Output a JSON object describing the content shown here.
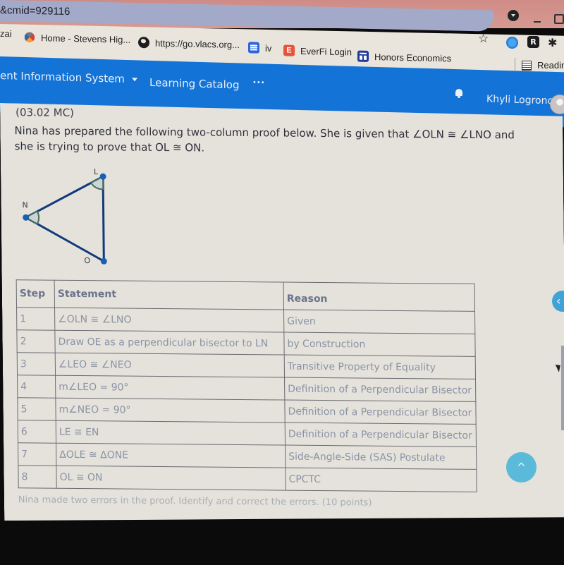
{
  "browser": {
    "url_fragment": "&cmid=929116",
    "bookmarks": [
      {
        "label": "zai"
      },
      {
        "label": "Home - Stevens Hig...",
        "icon": "stevens-logo-icon"
      },
      {
        "label": "https://go.vlacs.org...",
        "icon": "globe-icon"
      },
      {
        "label": "iv",
        "icon": "document-icon"
      },
      {
        "label": "EverFi Login",
        "icon": "everfi-icon",
        "icon_letter": "E"
      },
      {
        "label": "Honors Economics",
        "icon": "classroom-icon"
      }
    ],
    "extension_r_label": "R",
    "reading_list_label": "Reading",
    "star_glyph": "☆",
    "puzzle_glyph": "✱"
  },
  "navbar": {
    "items": [
      {
        "label": "ent Information System"
      },
      {
        "label": "Learning Catalog"
      },
      {
        "label": "•••"
      }
    ],
    "user_name": "Khyli Logrono"
  },
  "question": {
    "id": "(03.02 MC)",
    "text": "Nina has prepared the following two-column proof below. She is given that ∠OLN ≅ ∠LNO and she is trying to prove that OL ≅ ON.",
    "diagram": {
      "vertices": [
        {
          "name": "L"
        },
        {
          "name": "N"
        },
        {
          "name": "O"
        }
      ],
      "accent_color": "#1a5fb4",
      "edge_color": "#123a7a",
      "angle_mark_color": "#4a6b5a"
    },
    "table": {
      "headers": [
        "Step",
        "Statement",
        "Reason"
      ],
      "rows": [
        {
          "step": "1",
          "statement": "∠OLN ≅ ∠LNO",
          "reason": "Given"
        },
        {
          "step": "2",
          "statement": "Draw OE as a perpendicular bisector to LN",
          "reason": "by Construction"
        },
        {
          "step": "3",
          "statement": "∠LEO ≅ ∠NEO",
          "reason": "Transitive Property of Equality"
        },
        {
          "step": "4",
          "statement": "m∠LEO = 90°",
          "reason": "Definition of a Perpendicular Bisector"
        },
        {
          "step": "5",
          "statement": "m∠NEO = 90°",
          "reason": "Definition of a Perpendicular Bisector"
        },
        {
          "step": "6",
          "statement": "LE ≅ EN",
          "reason": "Definition of a Perpendicular Bisector"
        },
        {
          "step": "7",
          "statement": "ΔOLE ≅ ΔONE",
          "reason": "Side-Angle-Side (SAS) Postulate"
        },
        {
          "step": "8",
          "statement": "OL ≅ ON",
          "reason": "CPCTC"
        }
      ]
    },
    "prompt": "Nina made two errors in the proof. Identify and correct the errors. (10 points)"
  },
  "controls": {
    "back_glyph": "‹",
    "top_glyph": "^"
  },
  "colors": {
    "navbar": "#1473d6",
    "fab": "#5bbad9"
  }
}
